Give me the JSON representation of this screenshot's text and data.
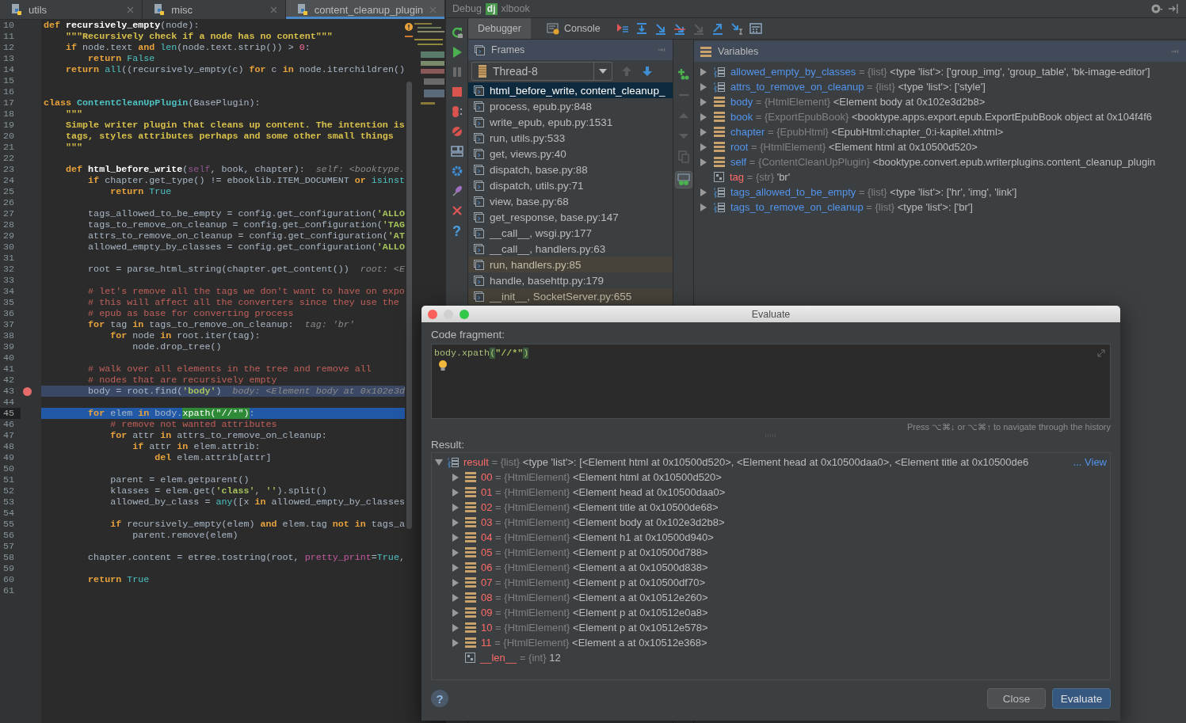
{
  "editor": {
    "tabs": [
      {
        "label": "utils",
        "selected": false
      },
      {
        "label": "misc",
        "selected": false
      },
      {
        "label": "content_cleanup_plugin",
        "selected": true
      }
    ],
    "lines": [
      {
        "number": "10",
        "breakpoint": false,
        "current": false,
        "tokens": [
          {
            "kind": "kw",
            "text": "def "
          },
          {
            "kind": "def",
            "text": "recursively_empty"
          },
          {
            "kind": "plain",
            "text": "(node):"
          }
        ]
      },
      {
        "number": "11",
        "breakpoint": false,
        "current": false,
        "tokens": [
          {
            "kind": "doc",
            "text": "    \"\"\"Recursively check if a node has no content\"\"\""
          }
        ]
      },
      {
        "number": "12",
        "breakpoint": false,
        "current": false,
        "tokens": [
          {
            "kind": "kw",
            "text": "    if "
          },
          {
            "kind": "plain",
            "text": "node.text "
          },
          {
            "kind": "kw",
            "text": "and "
          },
          {
            "kind": "fn",
            "text": "len"
          },
          {
            "kind": "plain",
            "text": "(node.text.strip()) > "
          },
          {
            "kind": "num",
            "text": "0"
          },
          {
            "kind": "plain",
            "text": ":"
          }
        ]
      },
      {
        "number": "13",
        "breakpoint": false,
        "current": false,
        "tokens": [
          {
            "kind": "kw",
            "text": "        return "
          },
          {
            "kind": "fn",
            "text": "False"
          }
        ]
      },
      {
        "number": "14",
        "breakpoint": false,
        "current": false,
        "tokens": [
          {
            "kind": "kw",
            "text": "    return "
          },
          {
            "kind": "fn",
            "text": "all"
          },
          {
            "kind": "plain",
            "text": "((recursively_empty(c) "
          },
          {
            "kind": "kw",
            "text": "for "
          },
          {
            "kind": "plain",
            "text": "c "
          },
          {
            "kind": "kw",
            "text": "in "
          },
          {
            "kind": "plain",
            "text": "node.iterchildren()"
          }
        ]
      },
      {
        "number": "15",
        "breakpoint": false,
        "current": false
      },
      {
        "number": "16",
        "breakpoint": false,
        "current": false
      },
      {
        "number": "17",
        "breakpoint": false,
        "current": false,
        "tokens": [
          {
            "kind": "kw",
            "text": "class "
          },
          {
            "kind": "cls",
            "text": "ContentCleanUpPlugin"
          },
          {
            "kind": "plain",
            "text": "(BasePlugin):"
          }
        ]
      },
      {
        "number": "18",
        "breakpoint": false,
        "current": false,
        "tokens": [
          {
            "kind": "doc",
            "text": "    \"\"\""
          }
        ]
      },
      {
        "number": "19",
        "breakpoint": false,
        "current": false,
        "tokens": [
          {
            "kind": "doc",
            "text": "    Simple writer plugin that cleans up content. The intention is"
          }
        ]
      },
      {
        "number": "20",
        "breakpoint": false,
        "current": false,
        "tokens": [
          {
            "kind": "doc",
            "text": "    tags, styles attributes perhaps and some other small things"
          }
        ]
      },
      {
        "number": "21",
        "breakpoint": false,
        "current": false,
        "tokens": [
          {
            "kind": "doc",
            "text": "    \"\"\""
          }
        ]
      },
      {
        "number": "22",
        "breakpoint": false,
        "current": false
      },
      {
        "number": "23",
        "breakpoint": false,
        "current": false,
        "tokens": [
          {
            "kind": "kw",
            "text": "    def "
          },
          {
            "kind": "def",
            "text": "html_before_write"
          },
          {
            "kind": "plain",
            "text": "("
          },
          {
            "kind": "self",
            "text": "self"
          },
          {
            "kind": "plain",
            "text": ", book, chapter):  "
          },
          {
            "kind": "hint",
            "text": "self: <booktype."
          }
        ]
      },
      {
        "number": "24",
        "breakpoint": false,
        "current": false,
        "tokens": [
          {
            "kind": "kw",
            "text": "        if "
          },
          {
            "kind": "plain",
            "text": "chapter.get_type() != ebooklib.ITEM_DOCUMENT "
          },
          {
            "kind": "kw",
            "text": "or "
          },
          {
            "kind": "fn",
            "text": "isinst"
          }
        ]
      },
      {
        "number": "25",
        "breakpoint": false,
        "current": false,
        "tokens": [
          {
            "kind": "kw",
            "text": "            return "
          },
          {
            "kind": "fn",
            "text": "True"
          }
        ]
      },
      {
        "number": "26",
        "breakpoint": false,
        "current": false
      },
      {
        "number": "27",
        "breakpoint": false,
        "current": false,
        "tokens": [
          {
            "kind": "plain",
            "text": "        tags_allowed_to_be_empty = config.get_configuration("
          },
          {
            "kind": "str",
            "text": "'ALLO"
          }
        ]
      },
      {
        "number": "28",
        "breakpoint": false,
        "current": false,
        "tokens": [
          {
            "kind": "plain",
            "text": "        tags_to_remove_on_cleanup = config.get_configuration("
          },
          {
            "kind": "str",
            "text": "'TAG"
          }
        ]
      },
      {
        "number": "29",
        "breakpoint": false,
        "current": false,
        "tokens": [
          {
            "kind": "plain",
            "text": "        attrs_to_remove_on_cleanup = config.get_configuration("
          },
          {
            "kind": "str",
            "text": "'AT"
          }
        ]
      },
      {
        "number": "30",
        "breakpoint": false,
        "current": false,
        "tokens": [
          {
            "kind": "plain",
            "text": "        allowed_empty_by_classes = config.get_configuration("
          },
          {
            "kind": "str",
            "text": "'ALLO"
          }
        ]
      },
      {
        "number": "31",
        "breakpoint": false,
        "current": false
      },
      {
        "number": "32",
        "breakpoint": false,
        "current": false,
        "tokens": [
          {
            "kind": "plain",
            "text": "        root = parse_html_string(chapter.get_content())  "
          },
          {
            "kind": "hint",
            "text": "root: <E"
          }
        ]
      },
      {
        "number": "33",
        "breakpoint": false,
        "current": false
      },
      {
        "number": "34",
        "breakpoint": false,
        "current": false,
        "tokens": [
          {
            "kind": "comment",
            "text": "        # let's remove all the tags we don't want to have on expo"
          }
        ]
      },
      {
        "number": "35",
        "breakpoint": false,
        "current": false,
        "tokens": [
          {
            "kind": "comment",
            "text": "        # this will affect all the converters since they use the"
          }
        ]
      },
      {
        "number": "36",
        "breakpoint": false,
        "current": false,
        "tokens": [
          {
            "kind": "comment",
            "text": "        # epub as base for converting process"
          }
        ]
      },
      {
        "number": "37",
        "breakpoint": false,
        "current": false,
        "tokens": [
          {
            "kind": "kw",
            "text": "        for "
          },
          {
            "kind": "plain",
            "text": "tag "
          },
          {
            "kind": "kw",
            "text": "in "
          },
          {
            "kind": "plain",
            "text": "tags_to_remove_on_cleanup:  "
          },
          {
            "kind": "hint",
            "text": "tag: 'br'"
          }
        ]
      },
      {
        "number": "38",
        "breakpoint": false,
        "current": false,
        "tokens": [
          {
            "kind": "kw",
            "text": "            for "
          },
          {
            "kind": "plain",
            "text": "node "
          },
          {
            "kind": "kw",
            "text": "in "
          },
          {
            "kind": "plain",
            "text": "root.iter(tag):"
          }
        ]
      },
      {
        "number": "39",
        "breakpoint": false,
        "current": false,
        "tokens": [
          {
            "kind": "plain",
            "text": "                node.drop_tree()"
          }
        ]
      },
      {
        "number": "40",
        "breakpoint": false,
        "current": false
      },
      {
        "number": "41",
        "breakpoint": false,
        "current": false,
        "tokens": [
          {
            "kind": "comment",
            "text": "        # walk over all elements in the tree and remove all"
          }
        ]
      },
      {
        "number": "42",
        "breakpoint": false,
        "current": false,
        "tokens": [
          {
            "kind": "comment",
            "text": "        # nodes that are recursively empty"
          }
        ]
      },
      {
        "number": "43",
        "breakpoint": true,
        "current": false,
        "tokens": [
          {
            "kind": "plain",
            "text": "        body = root.find("
          },
          {
            "kind": "str",
            "text": "'body'"
          },
          {
            "kind": "plain",
            "text": ")  "
          },
          {
            "kind": "hint",
            "text": "body: <Element body at 0x102e3d"
          }
        ]
      },
      {
        "number": "44",
        "breakpoint": false,
        "current": false
      },
      {
        "number": "45",
        "breakpoint": false,
        "current": true,
        "tokens": [
          {
            "kind": "kw",
            "text": "        for "
          },
          {
            "kind": "plain",
            "text": "elem "
          },
          {
            "kind": "kw",
            "text": "in "
          },
          {
            "kind": "plain",
            "text": "body."
          },
          {
            "kind": "match",
            "text": "xpath(\"//*\")"
          },
          {
            "kind": "plain",
            "text": ":"
          }
        ]
      },
      {
        "number": "46",
        "breakpoint": false,
        "current": false,
        "tokens": [
          {
            "kind": "comment",
            "text": "            # remove not wanted attributes"
          }
        ]
      },
      {
        "number": "47",
        "breakpoint": false,
        "current": false,
        "tokens": [
          {
            "kind": "kw",
            "text": "            for "
          },
          {
            "kind": "plain",
            "text": "attr "
          },
          {
            "kind": "kw",
            "text": "in "
          },
          {
            "kind": "plain",
            "text": "attrs_to_remove_on_cleanup:"
          }
        ]
      },
      {
        "number": "48",
        "breakpoint": false,
        "current": false,
        "tokens": [
          {
            "kind": "kw",
            "text": "                if "
          },
          {
            "kind": "plain",
            "text": "attr "
          },
          {
            "kind": "kw",
            "text": "in "
          },
          {
            "kind": "plain",
            "text": "elem.attrib:"
          }
        ]
      },
      {
        "number": "49",
        "breakpoint": false,
        "current": false,
        "tokens": [
          {
            "kind": "kw",
            "text": "                    del "
          },
          {
            "kind": "plain",
            "text": "elem.attrib[attr]"
          }
        ]
      },
      {
        "number": "50",
        "breakpoint": false,
        "current": false
      },
      {
        "number": "51",
        "breakpoint": false,
        "current": false,
        "tokens": [
          {
            "kind": "plain",
            "text": "            parent = elem.getparent()"
          }
        ]
      },
      {
        "number": "52",
        "breakpoint": false,
        "current": false,
        "tokens": [
          {
            "kind": "plain",
            "text": "            klasses = elem.get("
          },
          {
            "kind": "str",
            "text": "'class'"
          },
          {
            "kind": "plain",
            "text": ", "
          },
          {
            "kind": "str",
            "text": "''"
          },
          {
            "kind": "plain",
            "text": ").split()"
          }
        ]
      },
      {
        "number": "53",
        "breakpoint": false,
        "current": false,
        "tokens": [
          {
            "kind": "plain",
            "text": "            allowed_by_class = "
          },
          {
            "kind": "fn",
            "text": "any"
          },
          {
            "kind": "plain",
            "text": "([x "
          },
          {
            "kind": "kw",
            "text": "in "
          },
          {
            "kind": "plain",
            "text": "allowed_empty_by_classes"
          }
        ]
      },
      {
        "number": "54",
        "breakpoint": false,
        "current": false
      },
      {
        "number": "55",
        "breakpoint": false,
        "current": false,
        "tokens": [
          {
            "kind": "kw",
            "text": "            if "
          },
          {
            "kind": "plain",
            "text": "recursively_empty(elem) "
          },
          {
            "kind": "kw",
            "text": "and "
          },
          {
            "kind": "plain",
            "text": "elem.tag "
          },
          {
            "kind": "kw",
            "text": "not in "
          },
          {
            "kind": "plain",
            "text": "tags_a"
          }
        ]
      },
      {
        "number": "56",
        "breakpoint": false,
        "current": false,
        "tokens": [
          {
            "kind": "plain",
            "text": "                parent.remove(elem)"
          }
        ]
      },
      {
        "number": "57",
        "breakpoint": false,
        "current": false
      },
      {
        "number": "58",
        "breakpoint": false,
        "current": false,
        "tokens": [
          {
            "kind": "plain",
            "text": "        chapter.content = etree.tostring(root, "
          },
          {
            "kind": "kwarg",
            "text": "pretty_print"
          },
          {
            "kind": "plain",
            "text": "="
          },
          {
            "kind": "fn",
            "text": "True"
          },
          {
            "kind": "plain",
            "text": ","
          }
        ]
      },
      {
        "number": "59",
        "breakpoint": false,
        "current": false
      },
      {
        "number": "60",
        "breakpoint": false,
        "current": false,
        "tokens": [
          {
            "kind": "kw",
            "text": "        return "
          },
          {
            "kind": "fn",
            "text": "True"
          }
        ]
      },
      {
        "number": "61",
        "breakpoint": false,
        "current": false
      }
    ]
  },
  "debug": {
    "title": "Debug",
    "logo": "dj",
    "config": "xlbook",
    "help": "?",
    "tabs": [
      {
        "label": "Debugger",
        "selected": true
      },
      {
        "label": "Console",
        "selected": false
      }
    ],
    "frames_title": "Frames",
    "variables_title": "Variables",
    "thread": "Thread-8",
    "frames": [
      {
        "label": "html_before_write, content_cleanup_",
        "selected": true,
        "library": false
      },
      {
        "label": "process, epub.py:848",
        "selected": false,
        "library": false
      },
      {
        "label": "write_epub, epub.py:1531",
        "selected": false,
        "library": false
      },
      {
        "label": "run, utils.py:533",
        "selected": false,
        "library": false
      },
      {
        "label": "get, views.py:40",
        "selected": false,
        "library": false
      },
      {
        "label": "dispatch, base.py:88",
        "selected": false,
        "library": false
      },
      {
        "label": "dispatch, utils.py:71",
        "selected": false,
        "library": false
      },
      {
        "label": "view, base.py:68",
        "selected": false,
        "library": false
      },
      {
        "label": "get_response, base.py:147",
        "selected": false,
        "library": false
      },
      {
        "label": "__call__, wsgi.py:177",
        "selected": false,
        "library": false
      },
      {
        "label": "__call__, handlers.py:63",
        "selected": false,
        "library": false
      },
      {
        "label": "run, handlers.py:85",
        "selected": false,
        "library": true
      },
      {
        "label": "handle, basehttp.py:179",
        "selected": false,
        "library": false
      },
      {
        "label": "__init__, SocketServer.py:655",
        "selected": false,
        "library": true
      }
    ],
    "variables": [
      {
        "name": "allowed_empty_by_classes",
        "type": "= {list}",
        "value": "<type 'list'>: ['group_img', 'group_table', 'bk-image-editor']",
        "kind": "list",
        "expandable": true,
        "changed": false
      },
      {
        "name": "attrs_to_remove_on_cleanup",
        "type": "= {list}",
        "value": "<type 'list'>: ['style']",
        "kind": "list",
        "expandable": true,
        "changed": false
      },
      {
        "name": "body",
        "type": "= {HtmlElement}",
        "value": "<Element body at 0x102e3d2b8>",
        "kind": "object",
        "expandable": true,
        "changed": false
      },
      {
        "name": "book",
        "type": "= {ExportEpubBook}",
        "value": "<booktype.apps.export.epub.ExportEpubBook object at 0x104f4f6",
        "kind": "object",
        "expandable": true,
        "changed": false
      },
      {
        "name": "chapter",
        "type": "= {EpubHtml}",
        "value": "<EpubHtml:chapter_0:i-kapitel.xhtml>",
        "kind": "object",
        "expandable": true,
        "changed": false
      },
      {
        "name": "root",
        "type": "= {HtmlElement}",
        "value": "<Element html at 0x10500d520>",
        "kind": "object",
        "expandable": true,
        "changed": false
      },
      {
        "name": "self",
        "type": "= {ContentCleanUpPlugin}",
        "value": "<booktype.convert.epub.writerplugins.content_cleanup_plugin",
        "kind": "object",
        "expandable": true,
        "changed": false
      },
      {
        "name": "tag",
        "type": "= {str}",
        "value": "'br'",
        "kind": "primitive",
        "expandable": false,
        "changed": true
      },
      {
        "name": "tags_allowed_to_be_empty",
        "type": "= {list}",
        "value": "<type 'list'>: ['hr', 'img', 'link']",
        "kind": "list",
        "expandable": true,
        "changed": false
      },
      {
        "name": "tags_to_remove_on_cleanup",
        "type": "= {list}",
        "value": "<type 'list'>: ['br']",
        "kind": "list",
        "expandable": true,
        "changed": false
      }
    ]
  },
  "evaluate": {
    "title": "Evaluate",
    "code_label": "Code fragment:",
    "code": [
      {
        "kind": "frag",
        "text": "body.xpath"
      },
      {
        "kind": "brace",
        "text": "("
      },
      {
        "kind": "str",
        "text": "\"//*\""
      },
      {
        "kind": "brace",
        "text": ")"
      }
    ],
    "history_hint": "Press ⌥⌘↓ or ⌥⌘↑ to navigate through the history",
    "result_label": "Result:",
    "result": {
      "name": "result",
      "type": "= {list}",
      "value": "<type 'list'>: [<Element html at 0x10500d520>, <Element head at 0x10500daa0>, <Element title at 0x10500de6",
      "link": "... View",
      "kind": "list",
      "expanded": true,
      "children": [
        {
          "name": "00",
          "type": "= {HtmlElement}",
          "value": "<Element html at 0x10500d520>",
          "kind": "object",
          "expandable": true
        },
        {
          "name": "01",
          "type": "= {HtmlElement}",
          "value": "<Element head at 0x10500daa0>",
          "kind": "object",
          "expandable": true
        },
        {
          "name": "02",
          "type": "= {HtmlElement}",
          "value": "<Element title at 0x10500de68>",
          "kind": "object",
          "expandable": true
        },
        {
          "name": "03",
          "type": "= {HtmlElement}",
          "value": "<Element body at 0x102e3d2b8>",
          "kind": "object",
          "expandable": true
        },
        {
          "name": "04",
          "type": "= {HtmlElement}",
          "value": "<Element h1 at 0x10500d940>",
          "kind": "object",
          "expandable": true
        },
        {
          "name": "05",
          "type": "= {HtmlElement}",
          "value": "<Element p at 0x10500d788>",
          "kind": "object",
          "expandable": true
        },
        {
          "name": "06",
          "type": "= {HtmlElement}",
          "value": "<Element a at 0x10500d838>",
          "kind": "object",
          "expandable": true
        },
        {
          "name": "07",
          "type": "= {HtmlElement}",
          "value": "<Element p at 0x10500df70>",
          "kind": "object",
          "expandable": true
        },
        {
          "name": "08",
          "type": "= {HtmlElement}",
          "value": "<Element a at 0x10512e260>",
          "kind": "object",
          "expandable": true
        },
        {
          "name": "09",
          "type": "= {HtmlElement}",
          "value": "<Element p at 0x10512e0a8>",
          "kind": "object",
          "expandable": true
        },
        {
          "name": "10",
          "type": "= {HtmlElement}",
          "value": "<Element p at 0x10512e578>",
          "kind": "object",
          "expandable": true
        },
        {
          "name": "11",
          "type": "= {HtmlElement}",
          "value": "<Element a at 0x10512e368>",
          "kind": "object",
          "expandable": true
        },
        {
          "name": "__len__",
          "type": "= {int}",
          "value": "12",
          "kind": "primitive",
          "expandable": false
        }
      ]
    },
    "help": "?",
    "buttons": [
      {
        "label": "Close",
        "default": false
      },
      {
        "label": "Evaluate",
        "default": true
      }
    ]
  }
}
